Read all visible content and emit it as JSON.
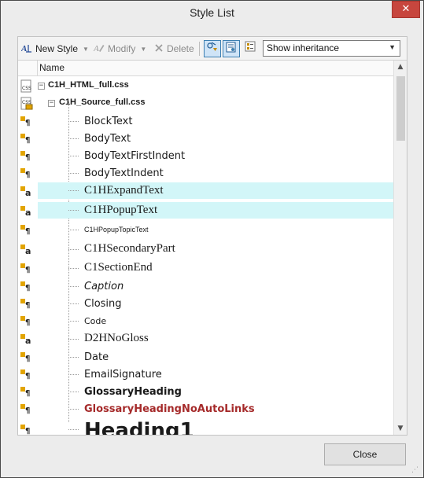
{
  "window": {
    "title": "Style List",
    "close_glyph": "✕"
  },
  "toolbar": {
    "new_style": "New Style",
    "modify": "Modify",
    "delete": "Delete",
    "view_dropdown": {
      "selected": "Show inheritance"
    }
  },
  "list": {
    "column_header": "Name",
    "rows": [
      {
        "label": "C1H_HTML_full.css",
        "icon": "css-file-icon",
        "level": 0,
        "expander": "−"
      },
      {
        "label": "C1H_Source_full.css",
        "icon": "locked-css-file-icon",
        "level": 1,
        "expander": "−"
      },
      {
        "label": "BlockText",
        "icon": "paragraph-style-icon",
        "level": 2
      },
      {
        "label": "BodyText",
        "icon": "paragraph-style-icon",
        "level": 2
      },
      {
        "label": "BodyTextFirstIndent",
        "icon": "paragraph-style-icon",
        "level": 2
      },
      {
        "label": "BodyTextIndent",
        "icon": "paragraph-style-icon",
        "level": 2
      },
      {
        "label": "C1HExpandText",
        "icon": "character-style-icon",
        "level": 2,
        "highlighted": true
      },
      {
        "label": "C1HPopupText",
        "icon": "character-style-icon",
        "level": 2,
        "highlighted": true
      },
      {
        "label": "C1HPopupTopicText",
        "icon": "paragraph-style-icon",
        "level": 2
      },
      {
        "label": "C1HSecondaryPart",
        "icon": "character-style-icon",
        "level": 2
      },
      {
        "label": "C1SectionEnd",
        "icon": "paragraph-style-icon",
        "level": 2
      },
      {
        "label": "Caption",
        "icon": "paragraph-style-icon",
        "level": 2
      },
      {
        "label": "Closing",
        "icon": "paragraph-style-icon",
        "level": 2
      },
      {
        "label": "Code",
        "icon": "paragraph-style-icon",
        "level": 2
      },
      {
        "label": "D2HNoGloss",
        "icon": "character-style-icon",
        "level": 2
      },
      {
        "label": "Date",
        "icon": "paragraph-style-icon",
        "level": 2
      },
      {
        "label": "EmailSignature",
        "icon": "paragraph-style-icon",
        "level": 2
      },
      {
        "label": "GlossaryHeading",
        "icon": "paragraph-style-icon",
        "level": 2
      },
      {
        "label": "GlossaryHeadingNoAutoLinks",
        "icon": "paragraph-style-icon",
        "level": 2,
        "color": "#a52a2a"
      },
      {
        "label": "Heading1",
        "icon": "paragraph-style-icon",
        "level": 2
      }
    ]
  },
  "footer": {
    "close_button": "Close"
  },
  "colors": {
    "highlight_row": "#d2f6f8",
    "accent_link_red": "#a52a2a",
    "toggle_active": "#cfe4f7"
  }
}
